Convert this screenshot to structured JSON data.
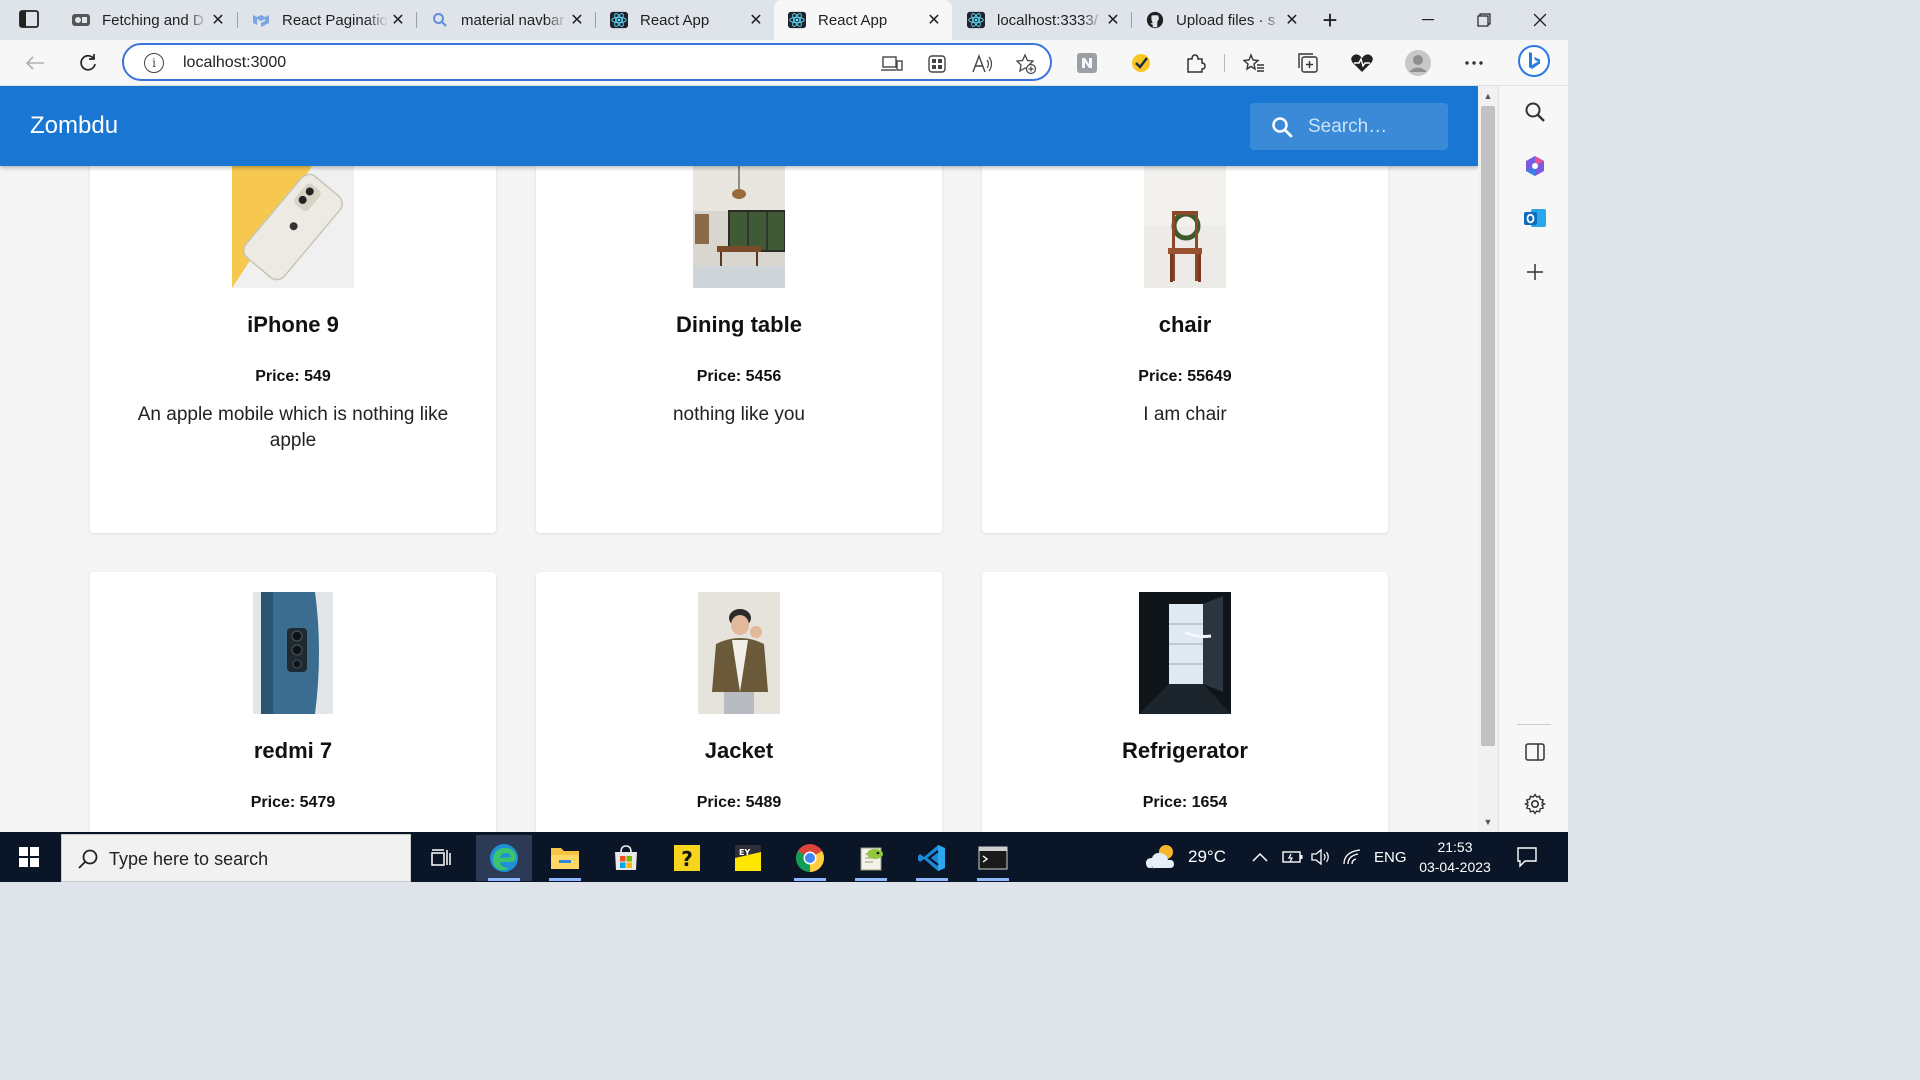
{
  "browser": {
    "tabs": [
      {
        "title": "Fetching and D",
        "active": false,
        "icon": "video-icon"
      },
      {
        "title": "React Paginatio",
        "active": false,
        "icon": "mui-icon"
      },
      {
        "title": "material navbar",
        "active": false,
        "icon": "search-icon"
      },
      {
        "title": "React App",
        "active": false,
        "icon": "react-icon"
      },
      {
        "title": "React App",
        "active": true,
        "icon": "react-icon"
      },
      {
        "title": "localhost:3333/",
        "active": false,
        "icon": "react-icon"
      },
      {
        "title": "Upload files · s",
        "active": false,
        "icon": "github-icon"
      }
    ],
    "address": "localhost:3000"
  },
  "app": {
    "brand": "Zombdu",
    "search_placeholder": "Search…",
    "accent_color": "#1976d2",
    "products": [
      {
        "name": "iPhone 9",
        "price": "Price: 549",
        "description": "An apple mobile which is nothing like apple",
        "image": "phone-photo"
      },
      {
        "name": "Dining table",
        "price": "Price: 5456",
        "description": "nothing like you",
        "image": "dining-room-photo"
      },
      {
        "name": "chair",
        "price": "Price: 55649",
        "description": "I am chair",
        "image": "chair-photo"
      },
      {
        "name": "redmi 7",
        "price": "Price: 5479",
        "description": "",
        "image": "phone-back-photo"
      },
      {
        "name": "Jacket",
        "price": "Price: 5489",
        "description": "",
        "image": "jacket-person-photo"
      },
      {
        "name": "Refrigerator",
        "price": "Price: 1654",
        "description": "",
        "image": "fridge-photo"
      }
    ]
  },
  "taskbar": {
    "search_placeholder": "Type here to search",
    "weather": "29°C",
    "language": "ENG",
    "time": "21:53",
    "date": "03-04-2023"
  }
}
